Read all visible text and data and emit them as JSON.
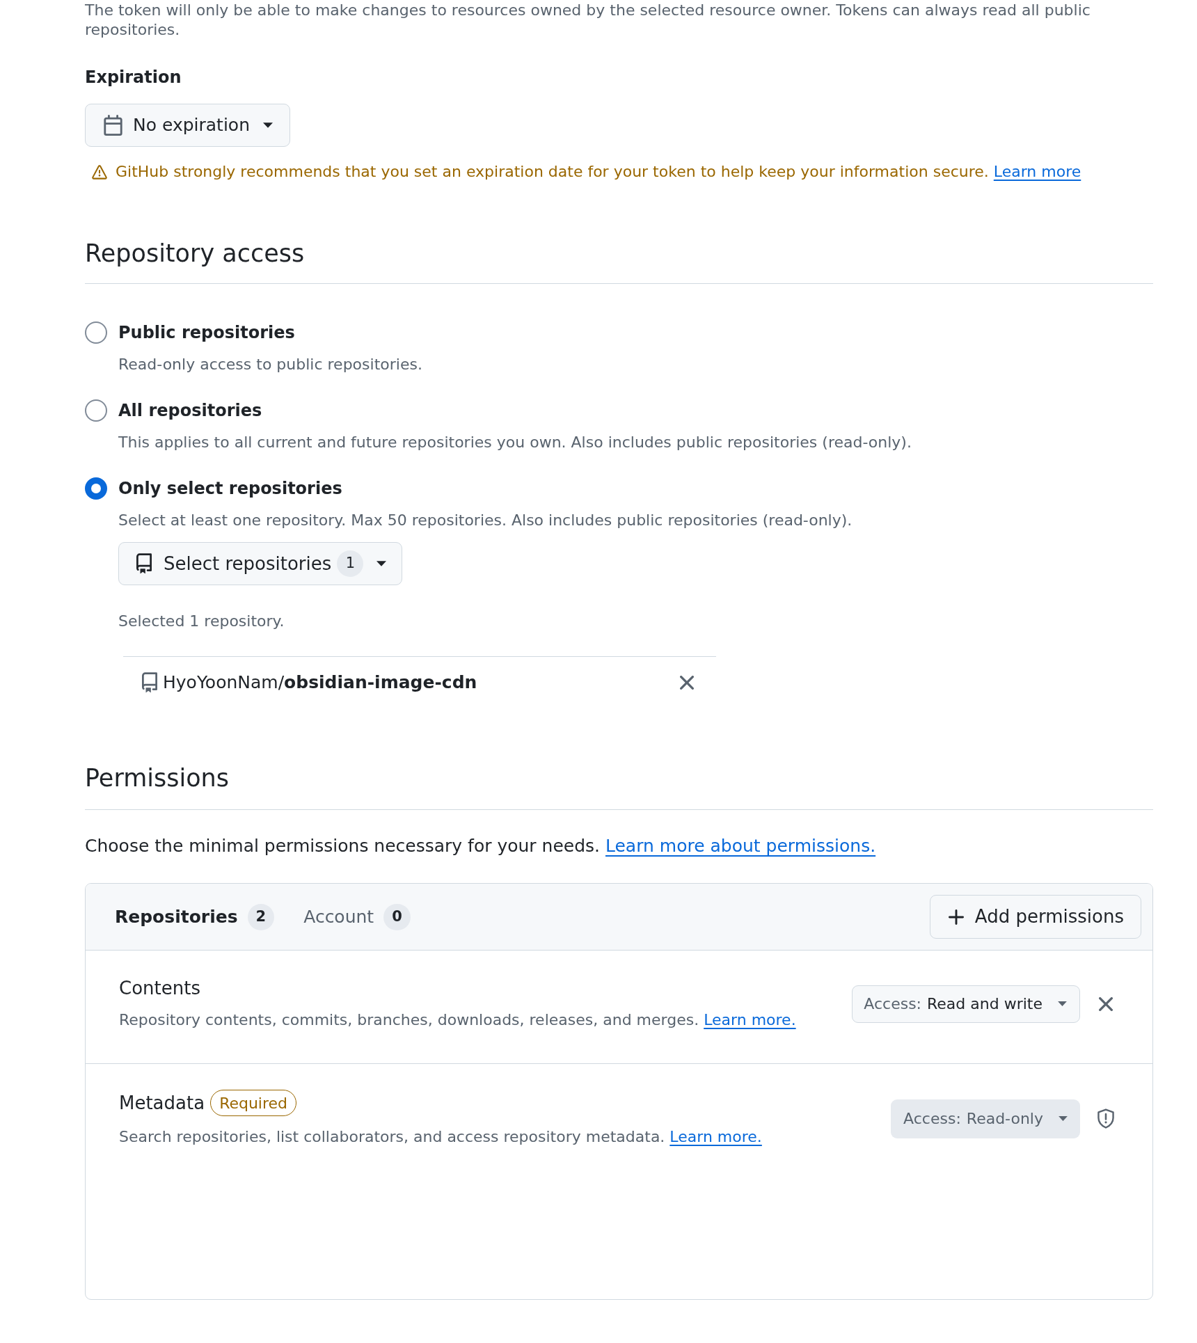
{
  "token_note": "The token will only be able to make changes to resources owned by the selected resource owner. Tokens can always read all public repositories.",
  "expiration": {
    "label": "Expiration",
    "dropdown_value": "No expiration",
    "warning": "GitHub strongly recommends that you set an expiration date for your token to help keep your information secure.",
    "warning_link": "Learn more"
  },
  "repository_access": {
    "title": "Repository access",
    "options": [
      {
        "label": "Public repositories",
        "description": "Read-only access to public repositories.",
        "selected": false
      },
      {
        "label": "All repositories",
        "description": "This applies to all current and future repositories you own. Also includes public repositories (read-only).",
        "selected": false
      },
      {
        "label": "Only select repositories",
        "description": "Select at least one repository. Max 50 repositories. Also includes public repositories (read-only).",
        "selected": true
      }
    ],
    "picker": {
      "label": "Select repositories",
      "count": "1"
    },
    "summary": "Selected 1 repository.",
    "selected_repositories": [
      {
        "full_name": "HyoYoonNam/**obsidian-image-cdn**"
      }
    ]
  },
  "permissions": {
    "title": "Permissions",
    "intro": "Choose the minimal permissions necessary for your needs.",
    "intro_link": "Learn more about permissions.",
    "tabs": [
      {
        "label": "Repositories",
        "count": "2",
        "selected": true
      },
      {
        "label": "Account",
        "count": "0",
        "selected": false
      }
    ],
    "add_button": "Add permissions",
    "items": [
      {
        "kind": "removable",
        "name": "Contents",
        "description": "Repository contents, commits, branches, downloads, releases, and merges.",
        "link": "Learn more.",
        "access_label": "Access:",
        "access_value": "Read and write"
      },
      {
        "kind": "required",
        "name": "Metadata",
        "badge": "Required",
        "description": "Search repositories, list collaborators, and access repository metadata.",
        "link": "Learn more.",
        "access_label": "Access:",
        "access_value": "Read-only"
      }
    ]
  }
}
